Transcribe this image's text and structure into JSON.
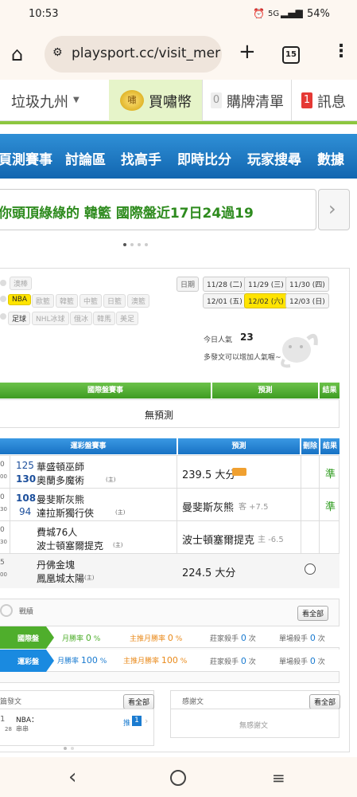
{
  "status": {
    "time": "10:53",
    "network": "5G",
    "battery": "54%"
  },
  "browser": {
    "url": "playsport.cc/visit_mer",
    "tab_count": "15"
  },
  "site_header": {
    "user": "垃圾九州",
    "buy": "買嘯幣",
    "cart_count": "0",
    "cart": "購牌清單",
    "msg_count": "1",
    "msg": "訊息",
    "badge_char": "嘯"
  },
  "nav": [
    "頁測賽事",
    "討論區",
    "找高手",
    "即時比分",
    "玩家搜尋",
    "數據"
  ],
  "banner": {
    "prefix": "你頭頂綠綠的",
    "team": "韓籃",
    "rest": "國際盤近17日24過19"
  },
  "filters": {
    "row1": [
      "澳棒"
    ],
    "row2": [
      "NBA",
      "歐籃",
      "韓籃",
      "中籃",
      "日籃",
      "澳籃"
    ],
    "row3": [
      "足球",
      "NHL冰球",
      "俄冰",
      "韓馬",
      "美足"
    ]
  },
  "dates": {
    "label": "日期",
    "row1": [
      "11/28 (二)",
      "11/29 (三)",
      "11/30 (四)"
    ],
    "row2": [
      "12/01 (五)",
      "12/02 (六)",
      "12/03 (日)"
    ]
  },
  "popularity": {
    "label": "今日人氣",
    "value": "23",
    "hint": "多發文可以增加人氣喔~"
  },
  "intl_table": {
    "col1": "國際盤賽事",
    "col2": "預測",
    "col3": "結果",
    "empty": "無預測"
  },
  "lottery_table": {
    "col1": "運彩盤賽事",
    "col2": "預測",
    "col3": "刪除",
    "col4": "結果",
    "rows": [
      {
        "time": "0",
        "time2": "00",
        "n1": "125",
        "n2": "130",
        "t1": "華盛頓巫師",
        "t2": "奧蘭多魔術",
        "home": "(主)",
        "pred": "239.5 大分",
        "extra": "",
        "result": "準"
      },
      {
        "time": "0",
        "time2": "30",
        "n1": "108",
        "n2": "94",
        "t1": "曼斐斯灰熊",
        "t2": "達拉斯獨行俠",
        "home": "(主)",
        "pred": "曼斐斯灰熊",
        "extra": "客 +7.5",
        "result": "準"
      },
      {
        "time": "0",
        "time2": "30",
        "n1": "",
        "n2": "",
        "t1": "費城76人",
        "t2": "波士頓塞爾提克",
        "home": "(主)",
        "pred": "波士頓塞爾提克",
        "extra": "主 -6.5",
        "result": ""
      },
      {
        "time": "5",
        "time2": "00",
        "n1": "",
        "n2": "",
        "t1": "丹佛金塊",
        "t2": "鳳凰城太陽",
        "home": "(主)",
        "pred": "224.5 大分",
        "extra": "",
        "result": ""
      }
    ]
  },
  "record": {
    "title": "戰績",
    "all_btn": "看全部",
    "intl": {
      "label": "國際盤",
      "month": "月勝率",
      "month_val": "0",
      "pct": "%",
      "main": "主推月勝率",
      "main_val": "0",
      "killer": "莊家殺手",
      "killer_val": "0",
      "unit": "次",
      "single": "單場殺手",
      "single_val": "0"
    },
    "lottery": {
      "label": "運彩盤",
      "month": "月勝率",
      "month_val": "100",
      "pct": "%",
      "main": "主推月勝率",
      "main_val": "100",
      "killer": "莊家殺手",
      "killer_val": "0",
      "unit": "次",
      "single": "單場殺手",
      "single_val": "0"
    }
  },
  "posts": {
    "title": "篇發文",
    "all_btn": "看全部",
    "item_num": "1",
    "item_date": "28",
    "item_title": "NBA：",
    "item_sub": "串串",
    "push": "推",
    "push_count": "1"
  },
  "thanks": {
    "title": "感謝文",
    "all_btn": "看全部",
    "empty": "無感謝文"
  },
  "colors": {
    "green": "#4fae2c",
    "blue": "#1a7bd0",
    "orange": "#e98a1b",
    "navy": "#1c4f9c"
  }
}
